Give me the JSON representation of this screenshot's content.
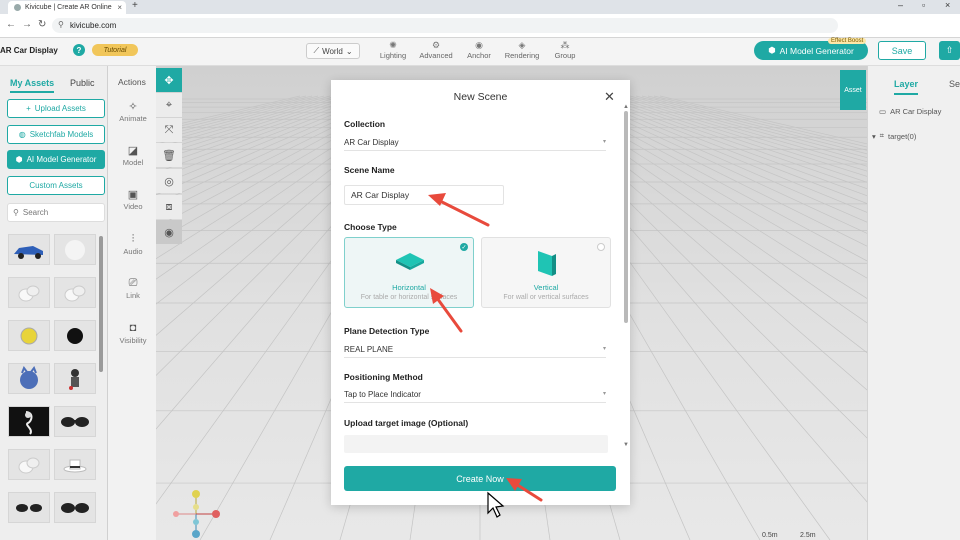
{
  "browser": {
    "tab_title": "Kivicube | Create AR Online",
    "url": "kivicube.com"
  },
  "header": {
    "project_name": "AR Car Display",
    "tutorial_label": "Tutorial",
    "world_label": "World",
    "tools": [
      {
        "label": "Lighting",
        "icon": "sun-icon"
      },
      {
        "label": "Advanced",
        "icon": "gear-icon"
      },
      {
        "label": "Anchor",
        "icon": "anchor-icon"
      },
      {
        "label": "Rendering",
        "icon": "paint-bucket-icon"
      },
      {
        "label": "Group",
        "icon": "group-icon"
      }
    ],
    "ai_button_label": "AI Model Generator",
    "effect_boost_label": "Effect Boost",
    "save_label": "Save"
  },
  "left_panel": {
    "tabs": [
      "My Assets",
      "Public"
    ],
    "upload_label": "Upload Assets",
    "sketchfab_label": "Sketchfab Models",
    "ai_label": "AI Model Generator",
    "custom_label": "Custom Assets",
    "search_placeholder": "Search"
  },
  "actions": {
    "header": "Actions",
    "items": [
      {
        "label": "Animate",
        "icon": "sparkle-icon"
      },
      {
        "label": "Model",
        "icon": "model-icon"
      },
      {
        "label": "Video",
        "icon": "video-icon"
      },
      {
        "label": "Audio",
        "icon": "audio-icon"
      },
      {
        "label": "Link",
        "icon": "link-icon"
      },
      {
        "label": "Visibility",
        "icon": "visibility-icon"
      }
    ]
  },
  "right_panel": {
    "asset_tab": "Asset",
    "tabs": [
      "Layer",
      "Set"
    ],
    "layers": [
      "AR Car Display",
      "target(0)"
    ]
  },
  "scale": {
    "left": "0.5m",
    "right": "2.5m"
  },
  "modal": {
    "title": "New Scene",
    "collection_label": "Collection",
    "collection_value": "AR Car Display",
    "scene_name_label": "Scene Name",
    "scene_name_value": "AR Car Display",
    "choose_type_label": "Choose Type",
    "types": [
      {
        "name": "Horizontal",
        "desc": "For table or horizontal surfaces",
        "selected": true
      },
      {
        "name": "Vertical",
        "desc": "For wall or vertical surfaces",
        "selected": false
      }
    ],
    "plane_detection_label": "Plane Detection Type",
    "plane_detection_value": "REAL PLANE",
    "positioning_label": "Positioning Method",
    "positioning_value": "Tap to Place Indicator",
    "upload_target_label": "Upload target image (Optional)",
    "create_label": "Create Now"
  },
  "colors": {
    "accent": "#1fa9a4",
    "annotation_arrow": "#e84a3c"
  }
}
